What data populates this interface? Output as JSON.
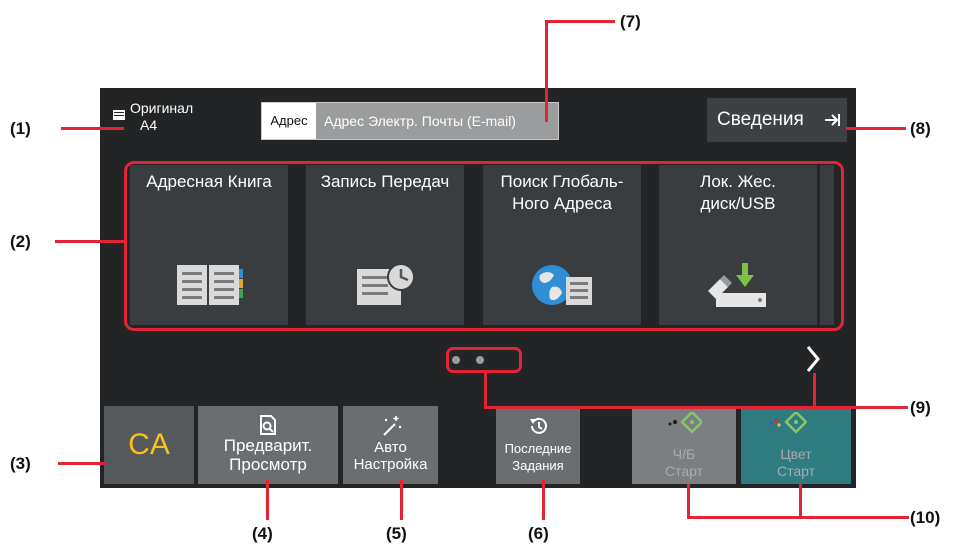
{
  "header": {
    "original_line1": "Оригинал",
    "original_line2": "A4",
    "address_label": "Адрес",
    "address_placeholder": "Адрес Электр. Почты (E-mail)",
    "info_button": "Сведения"
  },
  "tiles": [
    {
      "label_line1": "Адресная Книга",
      "label_line2": "",
      "icon": "address-book-icon"
    },
    {
      "label_line1": "Запись Передач",
      "label_line2": "",
      "icon": "transmission-log-icon"
    },
    {
      "label_line1": "Поиск Глобаль-",
      "label_line2": "Ного Адреса",
      "icon": "global-address-search-icon"
    },
    {
      "label_line1": "Лок. Жес.",
      "label_line2": "диск/USB",
      "icon": "usb-drive-icon"
    }
  ],
  "bottom": {
    "ca": "CA",
    "preview_line1": "Предварит.",
    "preview_line2": "Просмотр",
    "auto_line1": "Авто",
    "auto_line2": "Настройка",
    "last_line1": "Последние",
    "last_line2": "Задания",
    "bw_line1": "Ч/Б",
    "bw_line2": "Старт",
    "color_line1": "Цвет",
    "color_line2": "Старт"
  },
  "callouts": {
    "c1": "(1)",
    "c2": "(2)",
    "c3": "(3)",
    "c4": "(4)",
    "c5": "(5)",
    "c6": "(6)",
    "c7": "(7)",
    "c8": "(8)",
    "c9": "(9)",
    "c10": "(10)"
  },
  "colors": {
    "screen_bg": "#222426",
    "highlight": "#e22436",
    "ca_text": "#f5c21b",
    "color_start": "#2f7c80"
  }
}
